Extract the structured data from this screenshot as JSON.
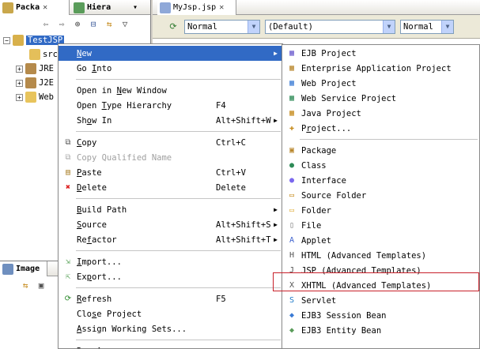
{
  "package_explorer": {
    "tabs": [
      {
        "label": "Packa",
        "active": true
      },
      {
        "label": "Hiera",
        "active": false
      }
    ],
    "close_glyph": "✕",
    "toolbar_icons": [
      "back-arrow-icon",
      "forward-arrow-icon",
      "link-icon",
      "collapse-all-icon",
      "link-with-editor-icon",
      "view-menu-icon"
    ],
    "tree": [
      {
        "label": "TestJSP",
        "expanded": true,
        "selected": true,
        "icon": "project-icon"
      },
      {
        "label": "src",
        "icon": "source-folder-icon"
      },
      {
        "label": "JRE",
        "icon": "library-icon"
      },
      {
        "label": "J2E",
        "icon": "library-icon"
      },
      {
        "label": "Web",
        "icon": "folder-icon"
      }
    ]
  },
  "image_view": {
    "tab_label": "Image"
  },
  "editor": {
    "tab_label": "MyJsp.jsp",
    "toolbar": {
      "paragraph_style": "Normal",
      "font": "(Default)",
      "size": "Normal"
    }
  },
  "context_menu": {
    "items": [
      {
        "type": "item",
        "label": "New",
        "mnemonic_index": 0,
        "submenu": true,
        "highlight": true
      },
      {
        "type": "item",
        "label": "Go Into",
        "mnemonic_index": 3
      },
      {
        "type": "separator"
      },
      {
        "type": "item",
        "label": "Open in New Window",
        "mnemonic_index": 8
      },
      {
        "type": "item",
        "label": "Open Type Hierarchy",
        "accel": "F4",
        "mnemonic_index": 5
      },
      {
        "type": "item",
        "label": "Show In",
        "accel": "Alt+Shift+W",
        "mnemonic_index": 2,
        "submenu": true
      },
      {
        "type": "separator"
      },
      {
        "type": "item",
        "label": "Copy",
        "accel": "Ctrl+C",
        "icon": "copy-icon",
        "mnemonic_index": 0
      },
      {
        "type": "item",
        "label": "Copy Qualified Name",
        "icon": "copy-qualified-icon",
        "disabled": true
      },
      {
        "type": "item",
        "label": "Paste",
        "accel": "Ctrl+V",
        "icon": "paste-icon",
        "mnemonic_index": 0
      },
      {
        "type": "item",
        "label": "Delete",
        "accel": "Delete",
        "icon": "delete-icon",
        "mnemonic_index": 0
      },
      {
        "type": "separator"
      },
      {
        "type": "item",
        "label": "Build Path",
        "mnemonic_index": 0,
        "submenu": true
      },
      {
        "type": "item",
        "label": "Source",
        "accel": "Alt+Shift+S",
        "mnemonic_index": 0,
        "submenu": true
      },
      {
        "type": "item",
        "label": "Refactor",
        "accel": "Alt+Shift+T",
        "mnemonic_index": 2,
        "submenu": true
      },
      {
        "type": "separator"
      },
      {
        "type": "item",
        "label": "Import...",
        "icon": "import-icon",
        "mnemonic_index": 0
      },
      {
        "type": "item",
        "label": "Export...",
        "icon": "export-icon",
        "mnemonic_index": 2
      },
      {
        "type": "separator"
      },
      {
        "type": "item",
        "label": "Refresh",
        "accel": "F5",
        "icon": "refresh-icon",
        "mnemonic_index": 0
      },
      {
        "type": "item",
        "label": "Close Project",
        "mnemonic_index": 3
      },
      {
        "type": "item",
        "label": "Assign Working Sets...",
        "mnemonic_index": 0
      },
      {
        "type": "separator"
      },
      {
        "type": "item",
        "label": "Run As",
        "mnemonic_index": 0,
        "submenu": true
      }
    ]
  },
  "new_submenu": {
    "items": [
      {
        "type": "item",
        "label": "EJB Project",
        "icon": "ejb-project-icon"
      },
      {
        "type": "item",
        "label": "Enterprise Application Project",
        "icon": "ear-project-icon"
      },
      {
        "type": "item",
        "label": "Web Project",
        "icon": "web-project-icon"
      },
      {
        "type": "item",
        "label": "Web Service Project",
        "icon": "web-service-project-icon"
      },
      {
        "type": "item",
        "label": "Java Project",
        "icon": "java-project-icon"
      },
      {
        "type": "item",
        "label": "Project...",
        "icon": "project-wizard-icon",
        "mnemonic_index": 1
      },
      {
        "type": "separator"
      },
      {
        "type": "item",
        "label": "Package",
        "icon": "package-icon"
      },
      {
        "type": "item",
        "label": "Class",
        "icon": "class-icon"
      },
      {
        "type": "item",
        "label": "Interface",
        "icon": "interface-icon"
      },
      {
        "type": "item",
        "label": "Source Folder",
        "icon": "source-folder-icon"
      },
      {
        "type": "item",
        "label": "Folder",
        "icon": "folder-icon"
      },
      {
        "type": "item",
        "label": "File",
        "icon": "file-icon"
      },
      {
        "type": "item",
        "label": "Applet",
        "icon": "applet-icon"
      },
      {
        "type": "item",
        "label": "HTML (Advanced Templates)",
        "icon": "html-icon"
      },
      {
        "type": "item",
        "label": "JSP (Advanced Templates)",
        "icon": "jsp-icon",
        "annotated": true
      },
      {
        "type": "item",
        "label": "XHTML (Advanced Templates)",
        "icon": "xhtml-icon"
      },
      {
        "type": "item",
        "label": "Servlet",
        "icon": "servlet-icon"
      },
      {
        "type": "item",
        "label": "EJB3 Session Bean",
        "icon": "ejb3-session-bean-icon"
      },
      {
        "type": "item",
        "label": "EJB3 Entity Bean",
        "icon": "ejb3-entity-bean-icon"
      }
    ]
  },
  "colors": {
    "selection": "#316ac5",
    "annotation_box": "#c8202a",
    "menu_background": "#ffffff",
    "chrome": "#d4d0c8"
  }
}
